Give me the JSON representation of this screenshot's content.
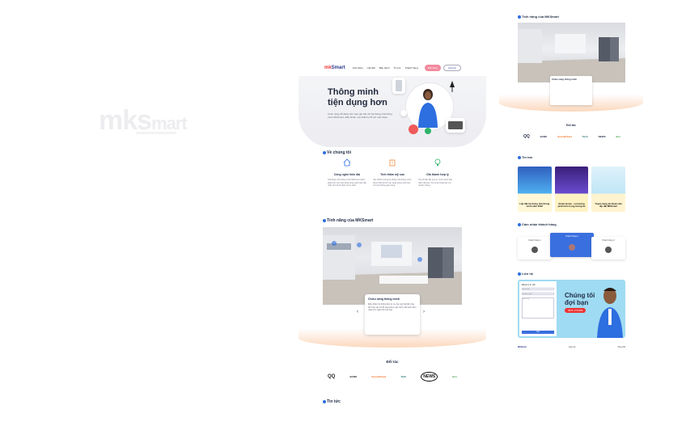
{
  "ghost_logo": {
    "brand": "mks",
    "suffix": "mart"
  },
  "nav": {
    "logo": "mk",
    "logo_accent": "Smart",
    "links": [
      "Giới thiệu",
      "Lắp đặt",
      "Bảo hành",
      "Tin tức",
      "Khách hàng",
      "Liên hệ"
    ],
    "cta": "Đặt hàng",
    "secondary": "Liên hệ"
  },
  "hero": {
    "title_line1": "Thông minh",
    "title_line2": "tiện dụng hơn",
    "text": "Cuộc sống dễ dàng hơn bao giờ hết với hệ thống nhà thông minh MKSmart, điều khiển mọi thiết bị chỉ với một chạm."
  },
  "about": {
    "heading": "Về chúng tôi",
    "items": [
      {
        "title": "Công nghệ hiện đại",
        "text": "Giải pháp nhà thông minh MKSmart được phát triển trên nền tảng công nghệ hiện đại nhất, kết nối ổn định và an toàn."
      },
      {
        "title": "Tính thẩm mỹ cao",
        "text": "Các thiết bị trong hệ thống nhà thông minh được thiết kế tinh tế, sang trọng, phù hợp với mọi không gian sống."
      },
      {
        "title": "Giá thành hợp lý",
        "text": "Chi phí lắp đặt hợp lý, chính sách bảo hành dài hạn, hỗ trợ kỹ thuật tận nơi, nhanh chóng."
      }
    ]
  },
  "features": {
    "heading": "Tính năng của MKSmart",
    "box_title": "Chiếu sáng thông minh",
    "box_text": "Điều khiển hệ thống đèn từ xa, hẹn giờ bật tắt, thay đổi màu sắc và độ sáng theo ngữ cảnh, tiết kiệm điện năng cho ngôi nhà của bạn."
  },
  "partners": {
    "heading": "Đối tác",
    "items": [
      "QQ",
      "BANK",
      "SoundCloud",
      "Tech",
      "NEWS",
      "Eco"
    ]
  },
  "news": {
    "heading": "Tin tức"
  },
  "right": {
    "features_heading": "Tính năng của MKSmart",
    "box_title": "Chiếu sáng thông minh",
    "partners_heading": "Đối tác",
    "news_heading": "Tin tức",
    "news_items": [
      "Lắp đặt hệ thống nhà thông minh năm 2022",
      "Smart Home - xu hướng phát triển trong tương lai",
      "Tuyển dụng kỹ thuật viên lắp đặt MKSmart"
    ],
    "tests_heading": "Cảm nhận khách hàng",
    "tests": [
      "Khách hàng 1",
      "Khách hàng 2",
      "Khách hàng 3"
    ],
    "contact_heading": "Liên hệ",
    "contact_title_1": "Chúng tôi",
    "contact_title_2": "đợi bạn",
    "form_title": "Đăng ký tư vấn",
    "form_fields": [
      "Họ và tên",
      "Số điện thoại",
      "Nội dung"
    ],
    "form_button": "Gửi",
    "phone": "0971.770.666",
    "footer": [
      "MKSmart",
      "Liên hệ",
      "Theo dõi"
    ]
  },
  "colors": {
    "accent": "#2d6ee0",
    "brand": "#2d3a8c",
    "red": "#e33333",
    "peach": "#fbd8bd"
  }
}
